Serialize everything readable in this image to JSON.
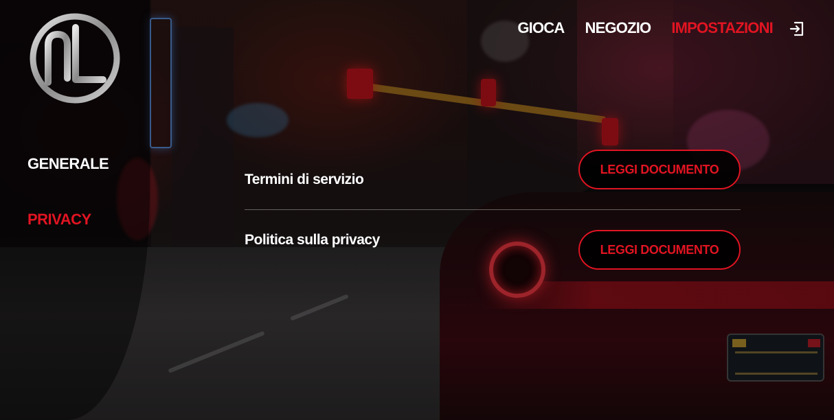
{
  "top_nav": {
    "items": [
      {
        "label": "GIOCA",
        "active": false
      },
      {
        "label": "NEGOZIO",
        "active": false
      },
      {
        "label": "IMPOSTAZIONI",
        "active": true
      }
    ],
    "logout_icon": "logout-icon"
  },
  "sidebar": {
    "logo_icon": "nl-logo",
    "items": [
      {
        "label": "GENERALE",
        "active": false
      },
      {
        "label": "PRIVACY",
        "active": true
      }
    ]
  },
  "privacy": {
    "rows": [
      {
        "label": "Termini di servizio",
        "button_label": "LEGGI DOCUMENTO"
      },
      {
        "label": "Politica sulla privacy",
        "button_label": "LEGGI DOCUMENTO"
      }
    ]
  },
  "colors": {
    "accent": "#e11422",
    "text": "#ffffff",
    "button_bg": "#000000"
  }
}
